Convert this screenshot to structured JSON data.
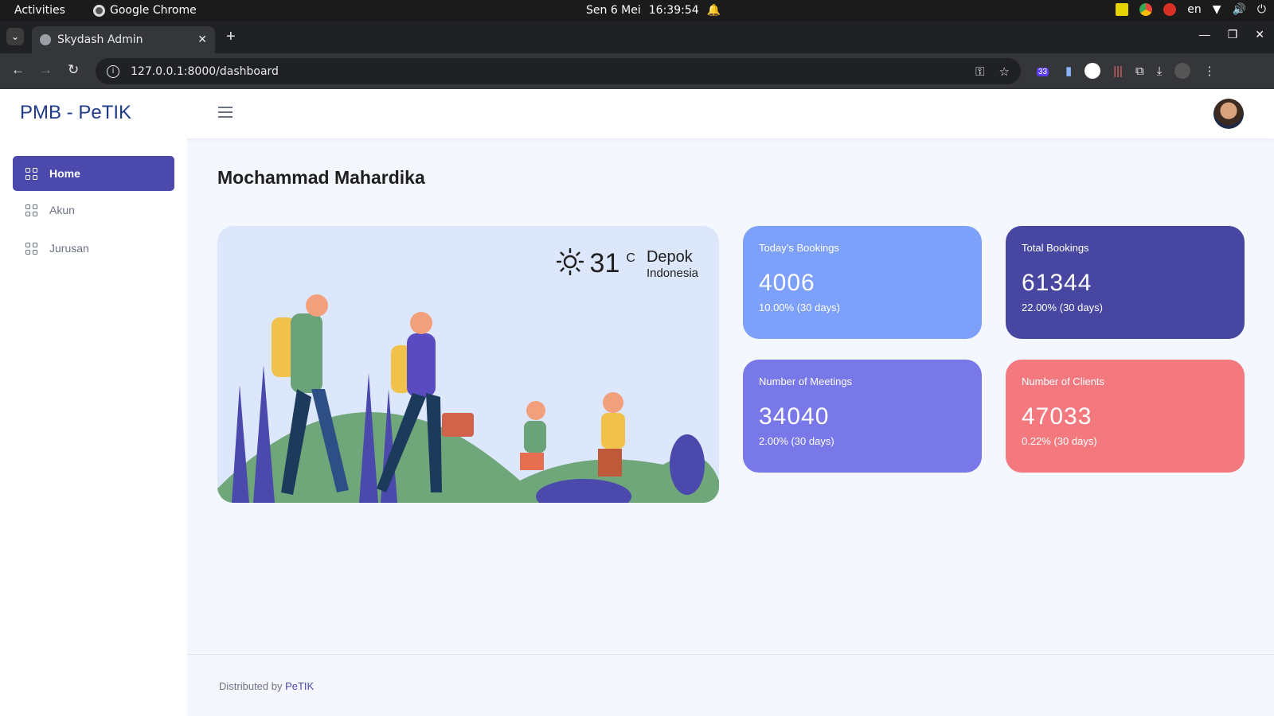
{
  "os": {
    "activities": "Activities",
    "app_name": "Google Chrome",
    "date": "Sen  6 Mei",
    "time": "16:39:54",
    "lang": "en"
  },
  "browser": {
    "tab_title": "Skydash Admin",
    "url": "127.0.0.1:8000/dashboard",
    "ext_badge": "33"
  },
  "app": {
    "brand": "PMB - PeTIK",
    "accent": "#4b49ac"
  },
  "sidebar": {
    "items": [
      {
        "label": "Home",
        "active": true
      },
      {
        "label": "Akun",
        "active": false
      },
      {
        "label": "Jurusan",
        "active": false
      }
    ]
  },
  "main": {
    "title": "Mochammad Mahardika",
    "weather": {
      "temp": "31",
      "unit": "C",
      "city": "Depok",
      "country": "Indonesia"
    },
    "cards": [
      {
        "label": "Today’s Bookings",
        "value": "4006",
        "sub": "10.00% (30 days)",
        "color": "#7da0fa"
      },
      {
        "label": "Total Bookings",
        "value": "61344",
        "sub": "22.00% (30 days)",
        "color": "#4747a1"
      },
      {
        "label": "Number of Meetings",
        "value": "34040",
        "sub": "2.00% (30 days)",
        "color": "#7978e9"
      },
      {
        "label": "Number of Clients",
        "value": "47033",
        "sub": "0.22% (30 days)",
        "color": "#f3797e"
      }
    ]
  },
  "footer": {
    "prefix": "Distributed by ",
    "link": "PeTIK"
  }
}
